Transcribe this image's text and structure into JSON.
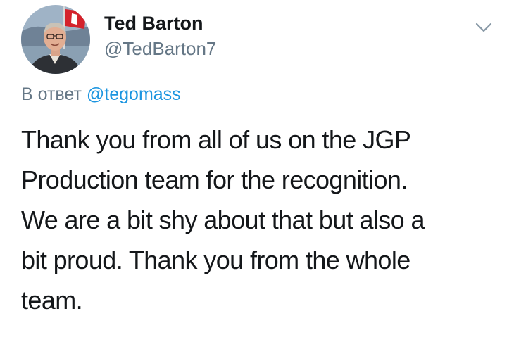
{
  "author": {
    "name": "Ted Barton",
    "handle": "@TedBarton7",
    "avatar_icon": "profile-photo"
  },
  "reply": {
    "prefix": "В ответ",
    "mention": "@tegomass"
  },
  "tweet": {
    "lines": [
      "Thank you from all of us on the JGP",
      "Production team for the recognition.",
      "We are a bit shy about that but also a",
      "bit proud. Thank you from the whole",
      "team."
    ]
  },
  "menu": {
    "icon": "chevron-down-icon"
  },
  "colors": {
    "name": "#14171a",
    "handle": "#657786",
    "link": "#1b95e0",
    "text": "#14171a"
  }
}
